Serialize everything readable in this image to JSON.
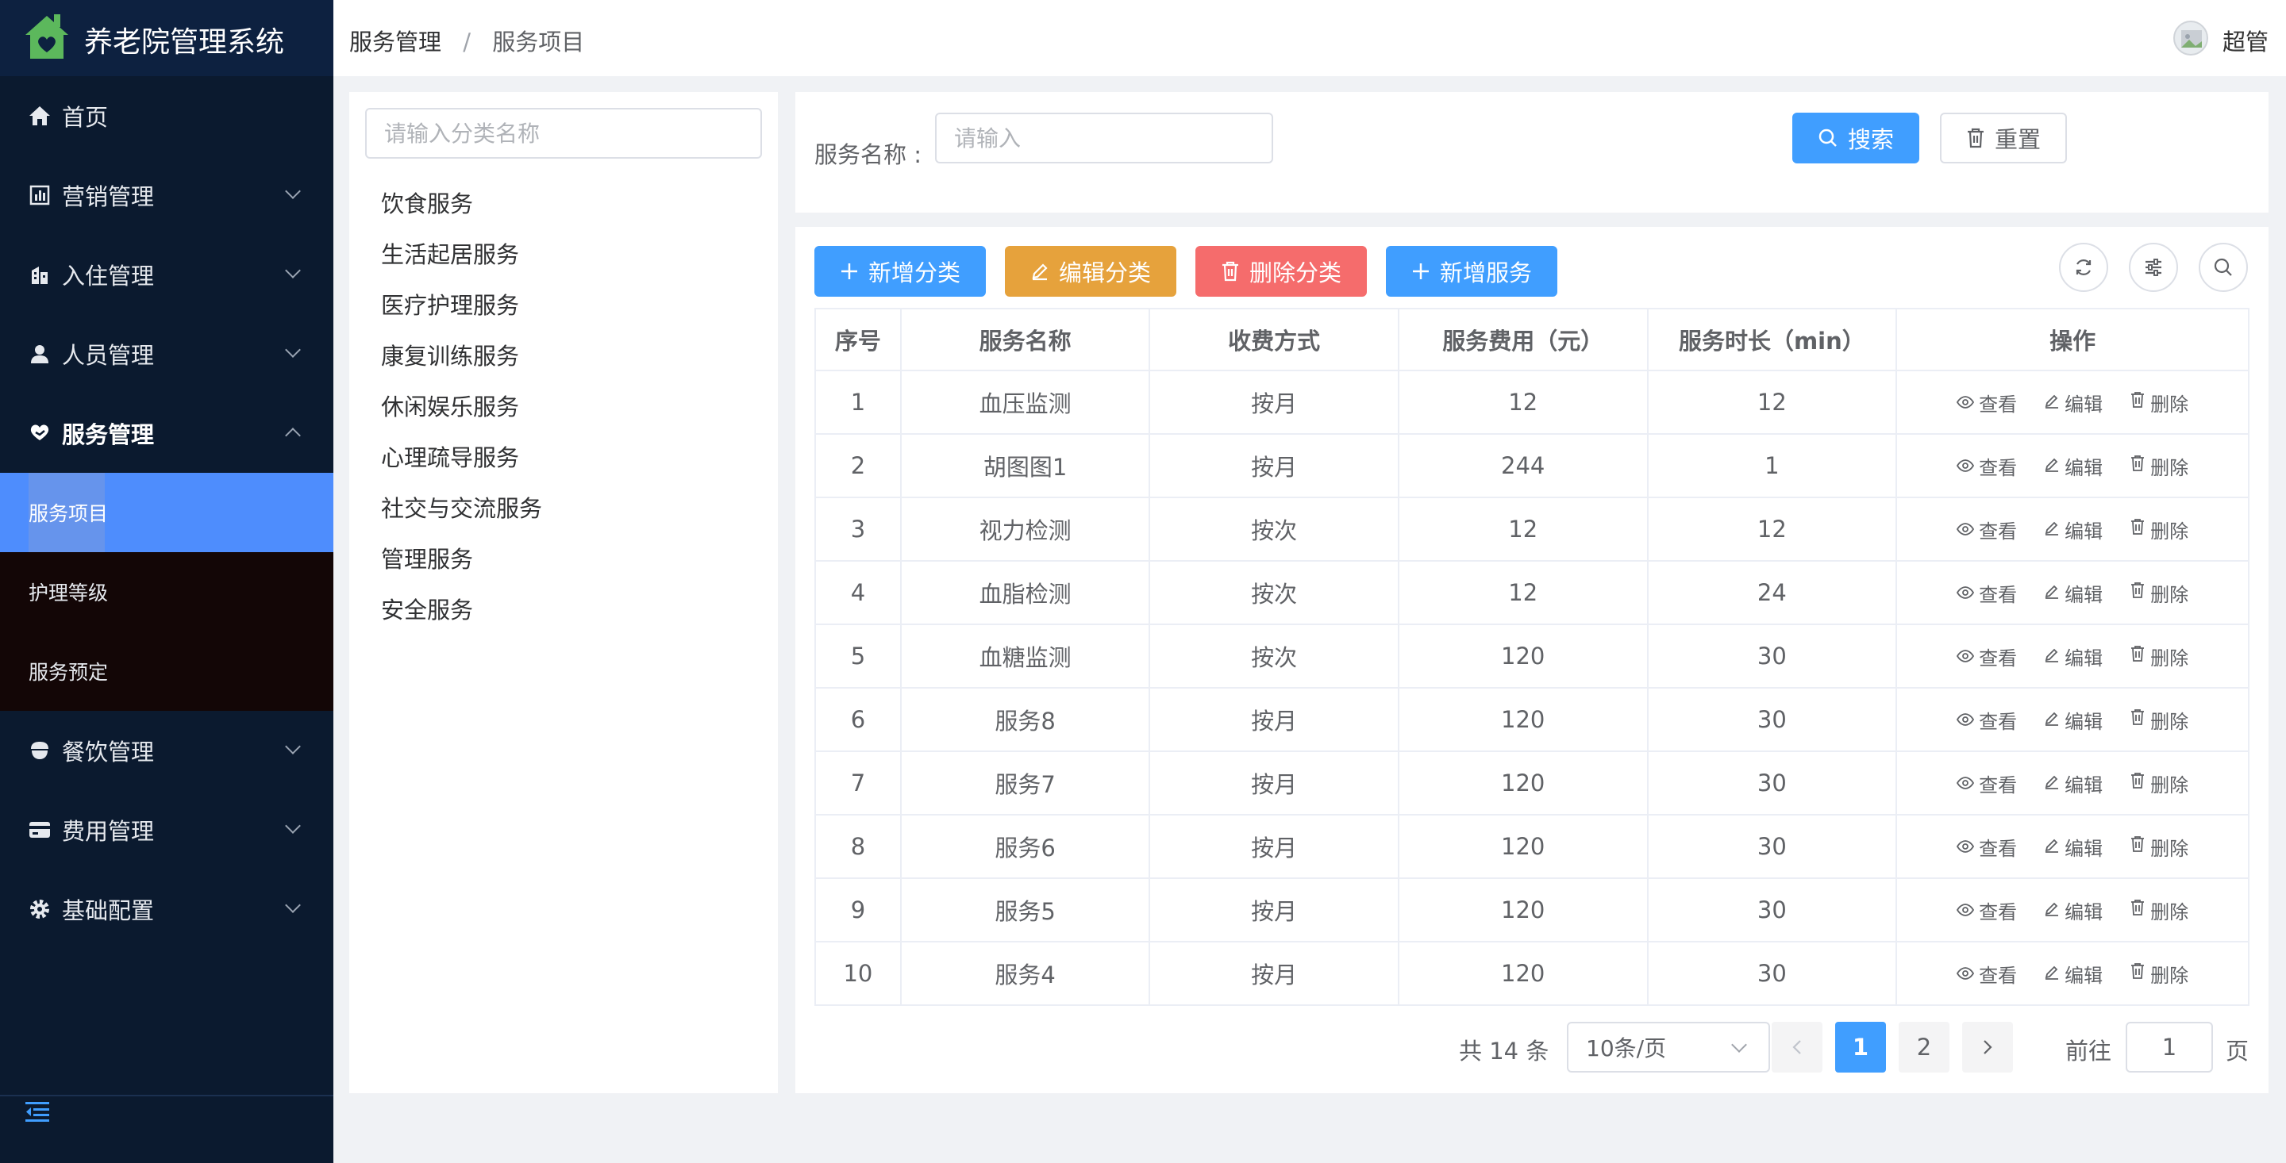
{
  "app": {
    "title": "养老院管理系统"
  },
  "sidebar": {
    "menu": [
      {
        "label": "首页",
        "icon": "home-icon"
      },
      {
        "label": "营销管理",
        "icon": "chart-icon"
      },
      {
        "label": "入住管理",
        "icon": "building-icon"
      },
      {
        "label": "人员管理",
        "icon": "user-icon"
      },
      {
        "label": "服务管理",
        "icon": "heart-hand-icon"
      },
      {
        "label": "餐饮管理",
        "icon": "bowl-icon"
      },
      {
        "label": "费用管理",
        "icon": "card-icon"
      },
      {
        "label": "基础配置",
        "icon": "gear-icon"
      }
    ],
    "submenu": [
      {
        "label": "服务项目"
      },
      {
        "label": "护理等级"
      },
      {
        "label": "服务预定"
      }
    ]
  },
  "header": {
    "breadcrumb": [
      "服务管理",
      "服务项目"
    ],
    "separator": "/",
    "user": "超管"
  },
  "categories": {
    "search_placeholder": "请输入分类名称",
    "items": [
      "饮食服务",
      "生活起居服务",
      "医疗护理服务",
      "康复训练服务",
      "休闲娱乐服务",
      "心理疏导服务",
      "社交与交流服务",
      "管理服务",
      "安全服务"
    ]
  },
  "search": {
    "label": "服务名称 :",
    "placeholder": "请输入",
    "search_btn": "搜索",
    "reset_btn": "重置"
  },
  "toolbar": {
    "add_category": "新增分类",
    "edit_category": "编辑分类",
    "delete_category": "删除分类",
    "add_service": "新增服务"
  },
  "table": {
    "headers": [
      "序号",
      "服务名称",
      "收费方式",
      "服务费用（元）",
      "服务时长（min）",
      "操作"
    ],
    "ops": [
      "查看",
      "编辑",
      "删除"
    ],
    "rows": [
      [
        "1",
        "血压监测",
        "按月",
        "12",
        "12"
      ],
      [
        "2",
        "胡图图1",
        "按月",
        "244",
        "1"
      ],
      [
        "3",
        "视力检测",
        "按次",
        "12",
        "12"
      ],
      [
        "4",
        "血脂检测",
        "按次",
        "12",
        "24"
      ],
      [
        "5",
        "血糖监测",
        "按次",
        "120",
        "30"
      ],
      [
        "6",
        "服务8",
        "按月",
        "120",
        "30"
      ],
      [
        "7",
        "服务7",
        "按月",
        "120",
        "30"
      ],
      [
        "8",
        "服务6",
        "按月",
        "120",
        "30"
      ],
      [
        "9",
        "服务5",
        "按月",
        "120",
        "30"
      ],
      [
        "10",
        "服务4",
        "按月",
        "120",
        "30"
      ]
    ]
  },
  "pagination": {
    "total_text": "共 14 条",
    "page_size": "10条/页",
    "pages": [
      "1",
      "2"
    ],
    "current": "1",
    "goto_label": "前往",
    "goto_value": "1",
    "page_suffix": "页"
  },
  "colors": {
    "sidebar_bg": "#0b1a2f",
    "primary": "#409eff",
    "warning": "#e6a23c",
    "danger": "#f56c6c",
    "logo_green": "#5cb85c"
  }
}
